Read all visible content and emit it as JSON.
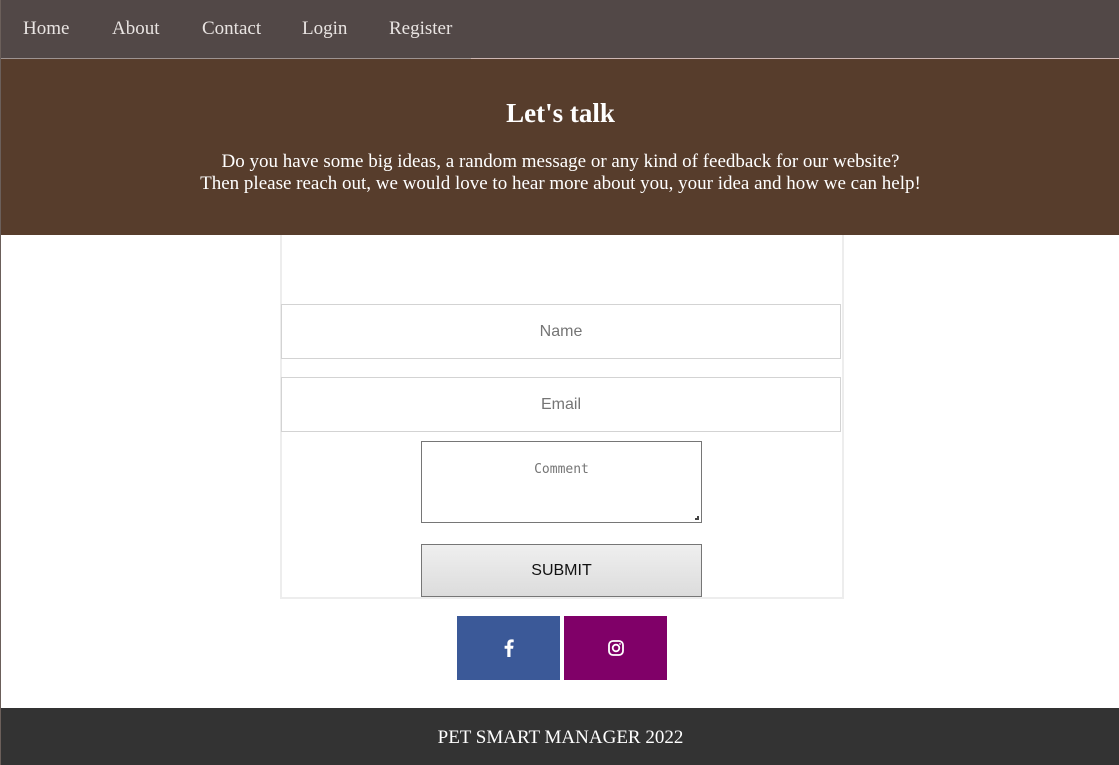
{
  "nav": {
    "items": [
      {
        "label": "Home"
      },
      {
        "label": "About"
      },
      {
        "label": "Contact"
      },
      {
        "label": "Login"
      },
      {
        "label": "Register"
      }
    ]
  },
  "hero": {
    "title": "Let's talk",
    "line1": "Do you have some big ideas, a random message or any kind of feedback for our website?",
    "line2": "Then please reach out, we would love to hear more about you, your idea and how we can help!"
  },
  "form": {
    "name_placeholder": "Name",
    "email_placeholder": "Email",
    "comment_placeholder": "Comment",
    "submit_label": "SUBMIT"
  },
  "social": {
    "facebook": {
      "icon": "facebook-icon",
      "color": "#3b5998"
    },
    "instagram": {
      "icon": "instagram-icon",
      "color": "#800068"
    }
  },
  "footer": {
    "text": "PET SMART MANAGER 2022"
  },
  "colors": {
    "nav_bg": "#524847",
    "hero_bg": "#573d2c",
    "footer_bg": "#333333"
  }
}
